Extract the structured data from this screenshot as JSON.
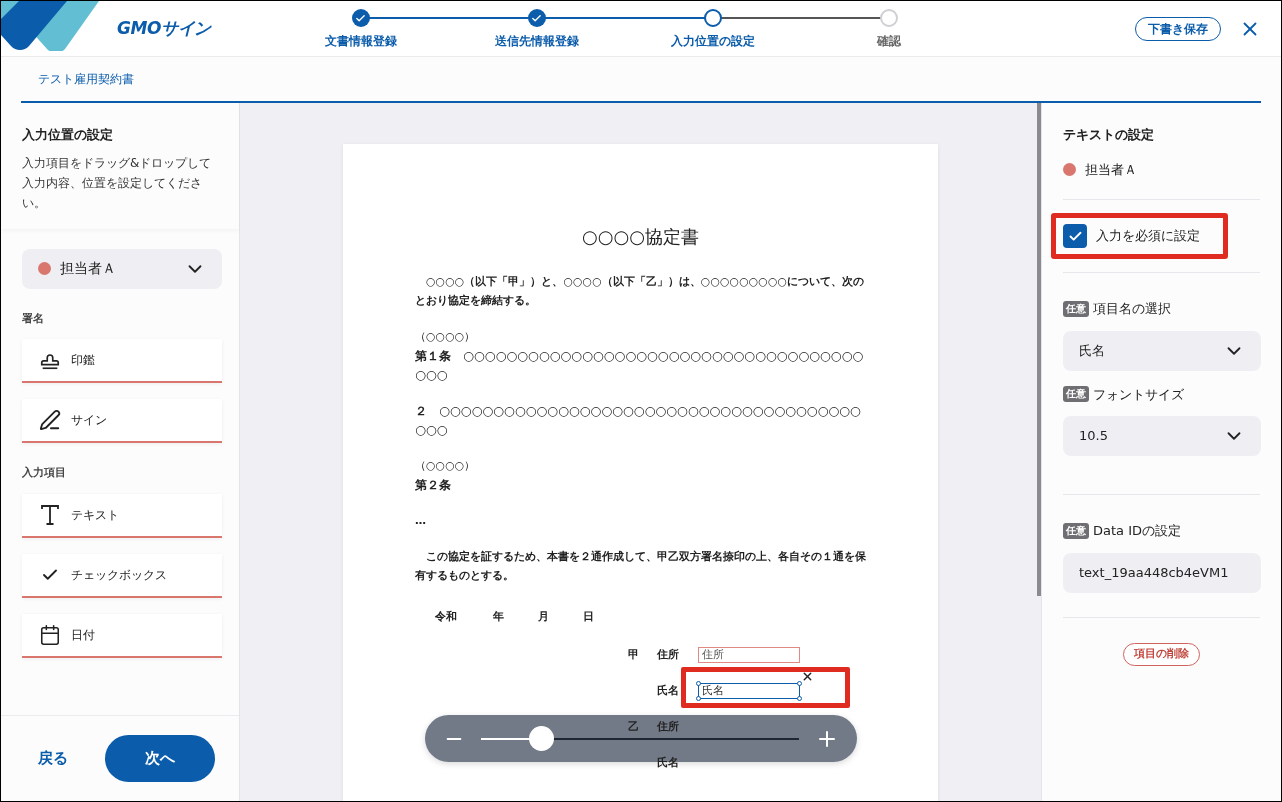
{
  "header": {
    "logo_text": "GMOサイン",
    "steps": [
      {
        "label": "文書情報登録",
        "completed": true,
        "selected": false
      },
      {
        "label": "送信先情報登録",
        "completed": true,
        "selected": false
      },
      {
        "label": "入力位置の設定",
        "completed": false,
        "selected": true
      },
      {
        "label": "確認",
        "completed": false,
        "selected": false
      }
    ],
    "save_draft": "下書き保存"
  },
  "tabs": [
    {
      "label": "テスト雇用契約書",
      "selected": true
    }
  ],
  "left_panel": {
    "title": "入力位置の設定",
    "description": "入力項目をドラッグ&ドロップして入力内容、位置を設定してください。",
    "signer": {
      "name": "担当者Ａ",
      "color": "#d9776f"
    },
    "groups": [
      {
        "label": "署名",
        "items": [
          {
            "kind": "stamp",
            "label": "印鑑"
          },
          {
            "kind": "signature",
            "label": "サイン"
          }
        ]
      },
      {
        "label": "入力項目",
        "items": [
          {
            "kind": "text",
            "label": "テキスト"
          },
          {
            "kind": "checkbox",
            "label": "チェックボックス"
          },
          {
            "kind": "date",
            "label": "日付"
          }
        ]
      }
    ],
    "back": "戻る",
    "next": "次へ"
  },
  "document": {
    "blocks": [
      {
        "kind": "title",
        "text": "○○○○協定書"
      },
      {
        "kind": "para",
        "text": "　○○○○（以下「甲」）と、○○○○（以下「乙」）は、○○○○○○○○○について、次のとおり協定を締結する。"
      },
      {
        "kind": "heading",
        "text": "（○○○○）"
      },
      {
        "kind": "article",
        "text": "第１条　○○○○○○○○○○○○○○○○○○○○○○○○○○○○○○○○○○○○○○○○"
      },
      {
        "kind": "clause",
        "text": "２　○○○○○○○○○○○○○○○○○○○○○○○○○○○○○○○○○○○○○○○○○○"
      },
      {
        "kind": "heading",
        "text": "（○○○○）"
      },
      {
        "kind": "article",
        "text": "第２条"
      },
      {
        "kind": "para",
        "text": "…"
      },
      {
        "kind": "para",
        "text": "　この協定を証するため、本書を２通作成して、甲乙双方署名捺印の上、各自その１通を保有するものとする。"
      }
    ],
    "date": [
      "令和",
      "年",
      "月",
      "日"
    ],
    "signature_rows": [
      {
        "party": "甲",
        "label": "住所",
        "field": {
          "text": "住所",
          "selected": false,
          "highlighted": false
        }
      },
      {
        "label": "氏名",
        "field": {
          "text": "氏名",
          "selected": true,
          "highlighted": true
        }
      },
      {
        "party": "乙",
        "label": "住所"
      },
      {
        "label": "氏名"
      }
    ]
  },
  "zoom": {
    "level": 0.19
  },
  "right_panel": {
    "title": "テキストの設定",
    "signer": {
      "name": "担当者Ａ",
      "color": "#d9776f"
    },
    "required": {
      "label": "入力を必須に設定",
      "checked": true,
      "highlighted": true
    },
    "fields": [
      {
        "kind": "select",
        "badge": "任意",
        "label": "項目名の選択",
        "value": "氏名"
      },
      {
        "kind": "select",
        "badge": "任意",
        "label": "フォントサイズ",
        "value": "10.5"
      },
      {
        "kind": "input",
        "badge": "任意",
        "label": "Data IDの設定",
        "value": "text_19aa448cb4eVM1"
      }
    ],
    "delete": "項目の削除"
  }
}
